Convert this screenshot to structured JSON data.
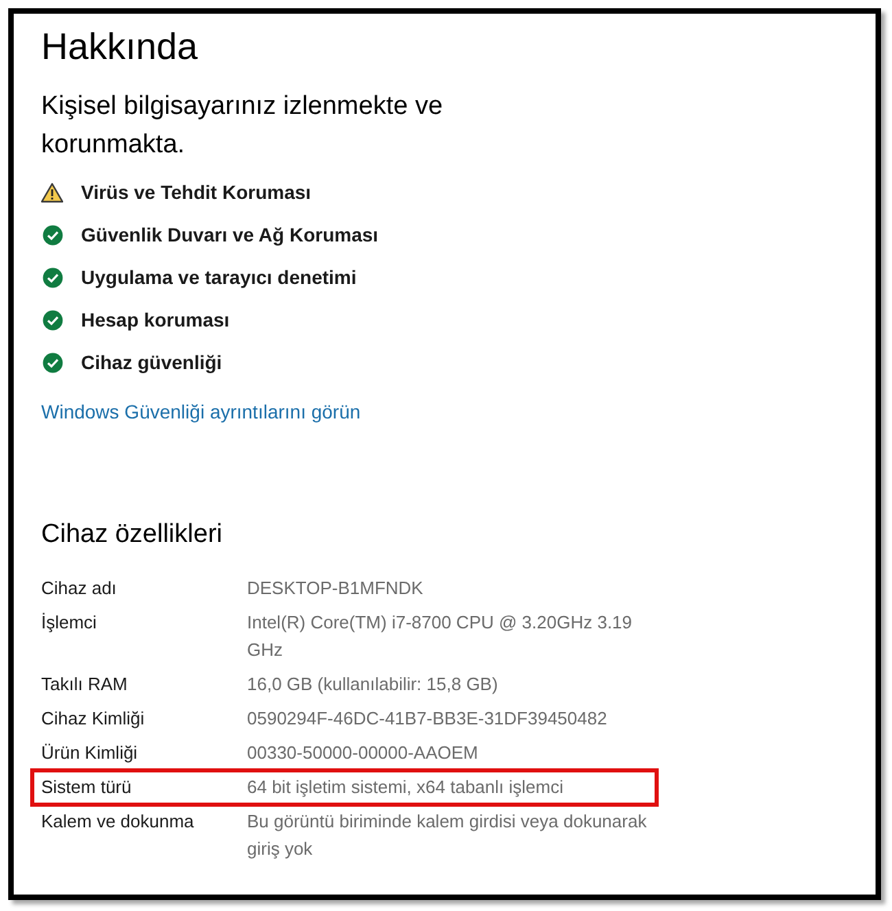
{
  "title": "Hakkında",
  "status_heading": "Kişisel bilgisayarınız izlenmekte ve korunmakta.",
  "status_items": [
    {
      "kind": "warning",
      "label": "Virüs ve Tehdit Koruması"
    },
    {
      "kind": "ok",
      "label": "Güvenlik Duvarı ve Ağ Koruması"
    },
    {
      "kind": "ok",
      "label": "Uygulama ve tarayıcı denetimi"
    },
    {
      "kind": "ok",
      "label": "Hesap koruması"
    },
    {
      "kind": "ok",
      "label": "Cihaz güvenliği"
    }
  ],
  "link": "Windows Güvenliği ayrıntılarını görün",
  "specs_heading": "Cihaz özellikleri",
  "specs": [
    {
      "label": "Cihaz adı",
      "value": "DESKTOP-B1MFNDK",
      "highlighted": false
    },
    {
      "label": "İşlemci",
      "value": "Intel(R) Core(TM) i7-8700 CPU @ 3.20GHz 3.19 GHz",
      "highlighted": false
    },
    {
      "label": "Takılı RAM",
      "value": "16,0 GB (kullanılabilir: 15,8 GB)",
      "highlighted": false
    },
    {
      "label": "Cihaz Kimliği",
      "value": "0590294F-46DC-41B7-BB3E-31DF39450482",
      "highlighted": false
    },
    {
      "label": "Ürün Kimliği",
      "value": "00330-50000-00000-AAOEM",
      "highlighted": false
    },
    {
      "label": "Sistem türü",
      "value": "64 bit işletim sistemi, x64 tabanlı işlemci",
      "highlighted": true
    },
    {
      "label": "Kalem ve dokunma",
      "value": "Bu görüntü biriminde kalem girdisi veya dokunarak giriş yok",
      "highlighted": false
    }
  ]
}
